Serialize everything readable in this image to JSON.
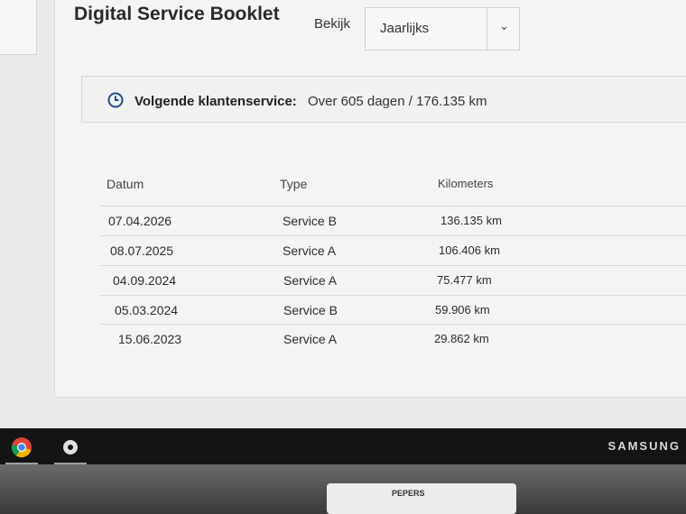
{
  "header": {
    "title": "Digital Service Booklet",
    "view_label": "Bekijk"
  },
  "view_select": {
    "value": "Jaarlijks",
    "chevron": "⌄",
    "icon": "chevron-down-icon"
  },
  "next_service": {
    "label": "Volgende klantenservice:",
    "value": "Over 605 dagen / 176.135 km",
    "icon": "clock-icon"
  },
  "table": {
    "columns": [
      "Datum",
      "Type",
      "Kilometers"
    ],
    "rows": [
      {
        "date": "07.04.2026",
        "type": "Service B",
        "km": "136.135 km"
      },
      {
        "date": "08.07.2025",
        "type": "Service A",
        "km": "106.406 km"
      },
      {
        "date": "04.09.2024",
        "type": "Service A",
        "km": "75.477 km"
      },
      {
        "date": "05.03.2024",
        "type": "Service B",
        "km": "59.906 km"
      },
      {
        "date": "15.06.2023",
        "type": "Service A",
        "km": "29.862 km"
      }
    ]
  },
  "monitor": {
    "brand": "SAMSUNG"
  },
  "sticker": {
    "text": "PEPERS"
  },
  "colors": {
    "accent": "#1f4e8c",
    "text": "#2a2a2a"
  }
}
